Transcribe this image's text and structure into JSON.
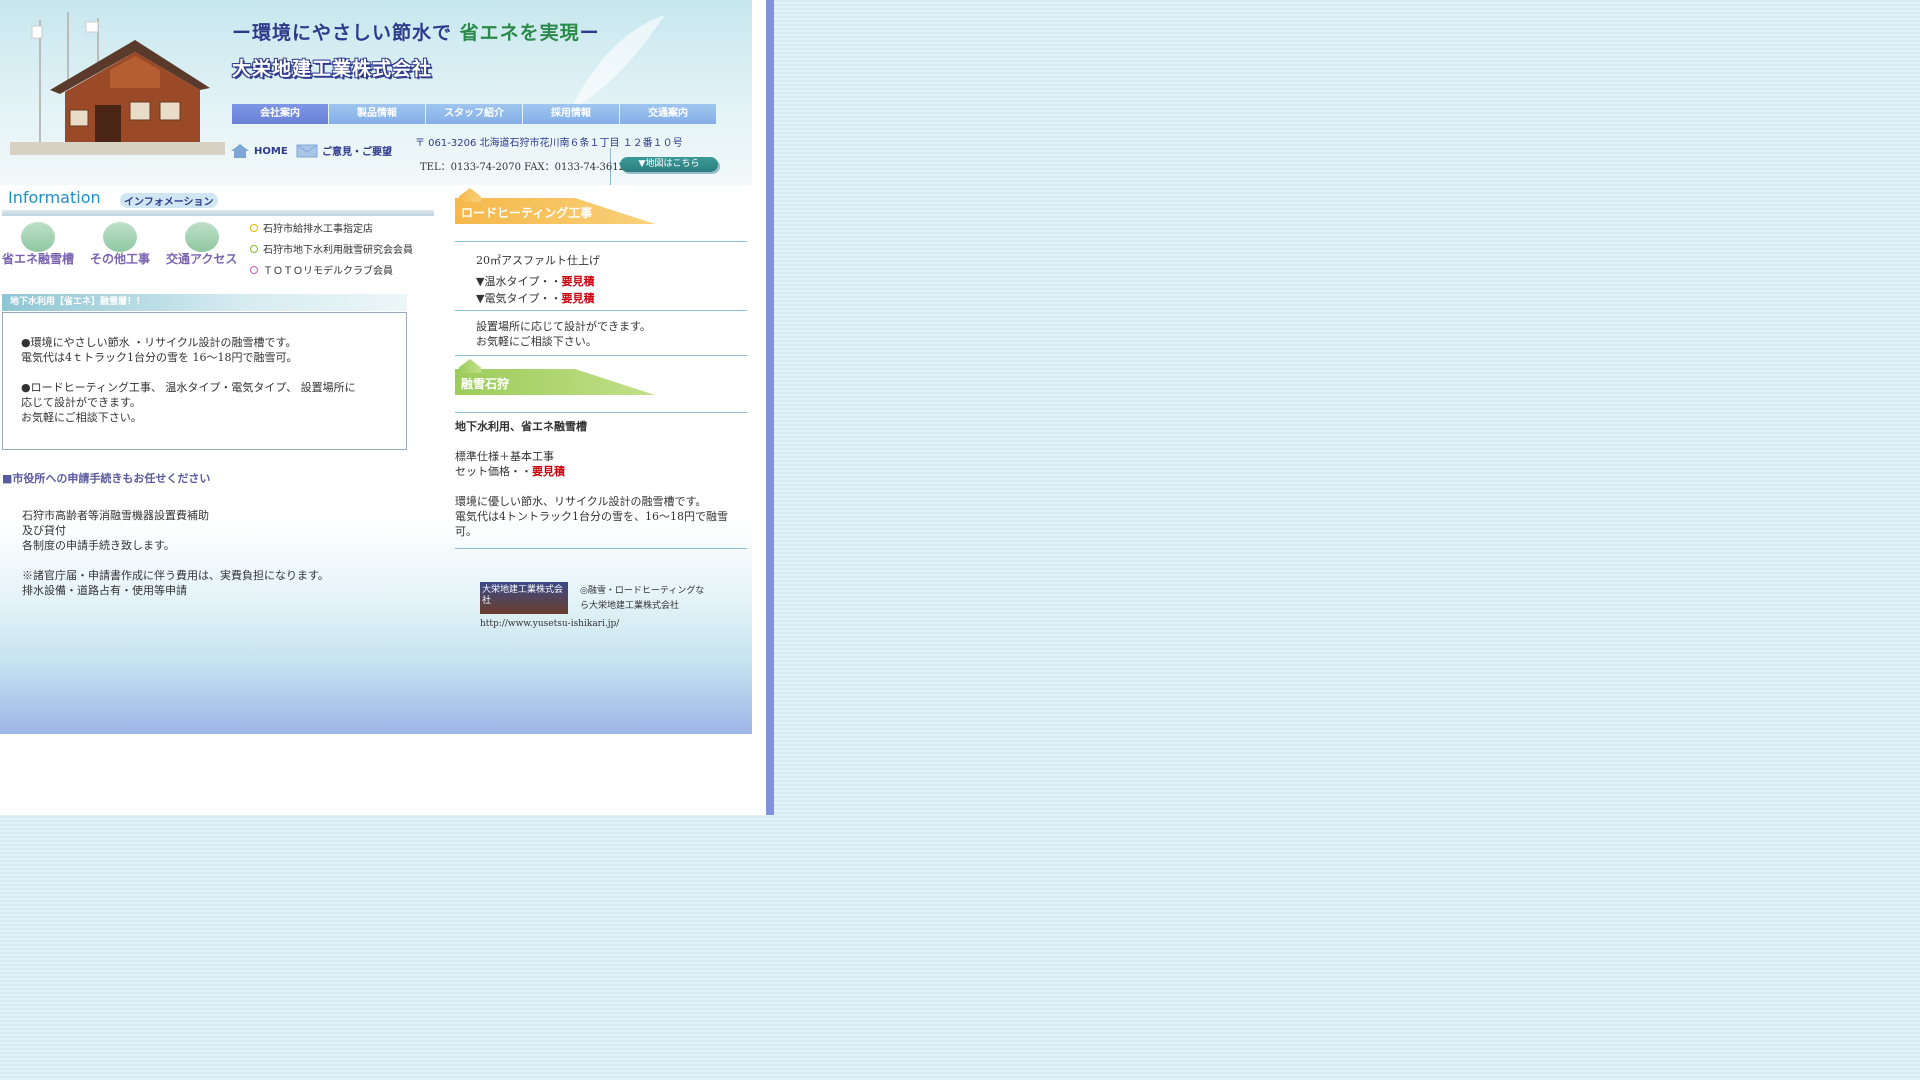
{
  "header": {
    "tagline_prefix": "ー環境にやさしい節水で",
    "tagline_green": "省エネを実現",
    "tagline_suffix": "ー",
    "company": "大栄地建工業株式会社",
    "nav": [
      "会社案内",
      "製品情報",
      "スタッフ紹介",
      "採用情報",
      "交通案内"
    ],
    "home_label": "HOME",
    "mail_label": "ご意見・ご要望",
    "address": "〒 061-3206 北海道石狩市花川南６条１丁目 １２番１０号",
    "tel": "TEL：0133-74-2070 FAX：0133-74-3612",
    "map_button": "▼地図はこちら"
  },
  "info": {
    "title": "Information",
    "subtitle": "インフォメーション",
    "categories": [
      "省エネ融雪槽",
      "その他工事",
      "交通アクセス"
    ],
    "certs": [
      "石狩市給排水工事指定店",
      "石狩市地下水利用融雪研究会会員",
      "ＴＯＴＯリモデルクラブ会員"
    ],
    "cert_colors": [
      "#e6b800",
      "#86b833",
      "#c060c0"
    ]
  },
  "notice": {
    "header": "地下水利用【省エネ】融雪層！！",
    "line1": "●環境にやさしい節水 ・リサイクル設計の融雪槽です。",
    "line2": "電気代は4ｔトラック1台分の雪を 16～18円で融雪可。",
    "line3": "●ロードヒーティング工事、 温水タイプ・電気タイプ、 設置場所に",
    "line4": "応じて設計ができます。",
    "line5": "お気軽にご相談下さい。"
  },
  "city": {
    "title": "■市役所への申請手続きもお任せください",
    "line1": "石狩市高齢者等消融雪機器設置費補助",
    "line2": "及び貸付",
    "line3": "各制度の申請手続き致します。",
    "line4": "※諸官庁届・申請書作成に伴う費用は、実費負担になります。",
    "line5": "排水設備・道路占有・使用等申請"
  },
  "road": {
    "banner": "ロードヒーティング工事",
    "finish": "20㎡アスファルト仕上げ",
    "hot_label": "▼温水タイプ・・",
    "hot_price": "要見積",
    "elec_label": "▼電気タイプ・・",
    "elec_price": "要見積",
    "note1": "設置場所に応じて設計ができます。",
    "note2": "お気軽にご相談下さい。"
  },
  "snow": {
    "banner": "融雪石狩",
    "heading": "地下水利用、省エネ融雪槽",
    "spec": "標準仕様＋基本工事",
    "set_label": "セット価格・・",
    "set_price": "要見積",
    "desc1": "環境に優しい節水、リサイクル設計の融雪槽です。",
    "desc2": "電気代は4トントラック1台分の雪を、16～18円で融雪",
    "desc3": "可。"
  },
  "ad": {
    "logo_text": "大栄地建工業株式会社",
    "text1": "◎融雪・ロードヒーティングな",
    "text2": "ら大栄地建工業株式会社",
    "url": "http://www.yusetsu-ishikari.jp/"
  }
}
